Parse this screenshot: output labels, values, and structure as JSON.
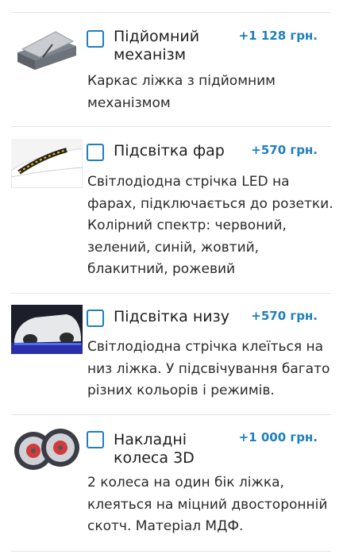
{
  "options": [
    {
      "icon": "lift-mechanism-image",
      "title": "Підйомний механізм",
      "price": "+1 128 грн.",
      "description": "Каркас ліжка з підйомним механізмом"
    },
    {
      "icon": "headlights-image",
      "title": "Підсвітка фар",
      "price": "+570 грн.",
      "description": "Світлодіодна стрічка LED на фарах, підключається до розетки. Колірний спектр: червоний, зелений, синій, жовтий, блакитний, рожевий"
    },
    {
      "icon": "underglow-image",
      "title": "Підсвітка низу",
      "price": "+570 грн.",
      "description": "Світлодіодна стрічка клеїться на низ ліжка. У підсвічування багато різних кольорів і режимів."
    },
    {
      "icon": "wheels-image",
      "title": "Накладні колеса 3D",
      "price": "+1 000 грн.",
      "description": "2 колеса на один бік ліжка, клеяться на міцний двосторонній скотч. Матеріал МДФ."
    }
  ],
  "colors": {
    "accent": "#1f7fbf",
    "divider": "#e4e4e4",
    "text": "#2a2a2a"
  }
}
